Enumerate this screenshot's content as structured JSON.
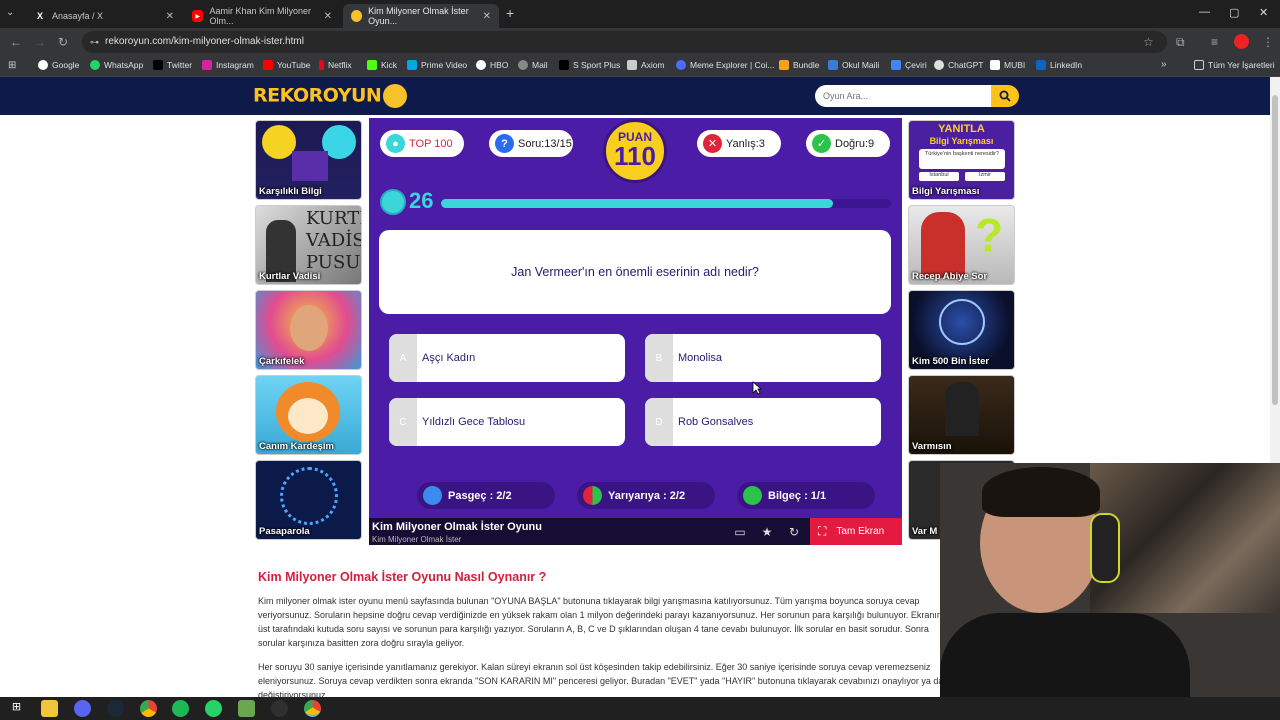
{
  "tabs": [
    {
      "title": "Anasayfa / X",
      "icon": "x-icon"
    },
    {
      "title": "Aamir Khan Kim Milyoner Olm...",
      "icon": "youtube-icon"
    },
    {
      "title": "Kim Milyoner Olmak İster Oyun...",
      "icon": "rekoroyun-icon"
    }
  ],
  "url": "rekoroyun.com/kim-milyoner-olmak-ister.html",
  "bookmarks": [
    "Google",
    "WhatsApp",
    "Twitter",
    "Instagram",
    "YouTube",
    "Netflix",
    "Kick",
    "Prime Video",
    "HBO",
    "Mail",
    "S Sport Plus",
    "Axiom",
    "Meme Explorer | Coi...",
    "Bundle",
    "Okul Maili",
    "Çeviri",
    "ChatGPT",
    "MUBI",
    "LinkedIn"
  ],
  "bookmarks_folder": "Tüm Yer İşaretleri",
  "site": {
    "logo": "REKOROYUN",
    "search_placeholder": "Oyun Ara..."
  },
  "left_games": [
    "Karşılıklı Bilgi",
    "Kurtlar Vadisi",
    "Çarkıfelek",
    "Canım Kardeşim",
    "Pasaparola"
  ],
  "right_games": [
    "Bilgi Yarışması",
    "Recep Abiye Sor",
    "Kim 500 Bin İster",
    "Varmısın",
    "Var M"
  ],
  "right_thumb_text": {
    "headline1": "YANITLA",
    "headline2": "Bilgi Yarışması",
    "question": "Türkiye'nin başkenti neresidir?",
    "opt1": "İstanbul",
    "opt2": "İzmir"
  },
  "game": {
    "top100": "TOP 100",
    "question_count": "Soru:13/15",
    "score_label": "PUAN",
    "score": "110",
    "wrong": "Yanlış:3",
    "correct": "Doğru:9",
    "timer": "26",
    "timer_fraction": 0.87,
    "question": "Jan Vermeer'ın en önemli eserinin adı nedir?",
    "answers": [
      {
        "letter": "A",
        "text": "Aşçı Kadın"
      },
      {
        "letter": "B",
        "text": "Monolisa"
      },
      {
        "letter": "C",
        "text": "Yıldızlı Gece Tablosu"
      },
      {
        "letter": "D",
        "text": "Rob Gonsalves"
      }
    ],
    "jokers": [
      "Pasgeç : 2/2",
      "Yarıyarıya : 2/2",
      "Bilgeç : 1/1"
    ],
    "title": "Kim Milyoner Olmak İster Oyunu",
    "subtitle": "Kim Milyoner Olmak İster",
    "fullscreen": "Tam Ekran"
  },
  "article": {
    "title": "Kim Milyoner Olmak İster Oyunu Nasıl Oynanır ?",
    "p1": "Kim milyoner olmak ister oyunu menü sayfasında bulunan \"OYUNA BAŞLA\" butonuna tıklayarak bilgi yarışmasına katılıyorsunuz. Tüm yarışma boyunca soruya cevap veriyorsunuz. Soruların hepsine doğru cevap verdiğinizde en yüksek rakam olan 1 milyon değerindeki parayı kazanıyorsunuz. Her sorunun para karşılığı bulunuyor. Ekranın üst tarafındaki kutuda soru sayısı ve sorunun para karşılığı yazıyor. Soruların A, B, C ve D şıklarından oluşan 4 tane cevabı bulunuyor. İlk sorular en basit sorudur. Sonra sorular karşınıza basitten zora doğru sırayla geliyor.",
    "p2": "Her soruyu 30 saniye içerisinde yanıtlamanız gerekiyor. Kalan süreyi ekranın sol üst köşesinden takip edebilirsiniz. Eğer 30 saniye içerisinde soruya cevap veremezseniz eleniyorsunuz. Soruya cevap verdikten sonra ekranda \"SON KARARIN MI\" penceresi geliyor. Buradan \"EVET\" yada \"HAYIR\" butonuna tıklayarak cevabınızı onaylıyor ya da değiştiriyorsunuz."
  },
  "colors": {
    "game_bg": "#4b1da6",
    "accent": "#3ad6d9",
    "score": "#f7cf1c",
    "header": "#0d1a4a",
    "fullscreen": "#e51a40",
    "article_title": "#d21f3c"
  }
}
